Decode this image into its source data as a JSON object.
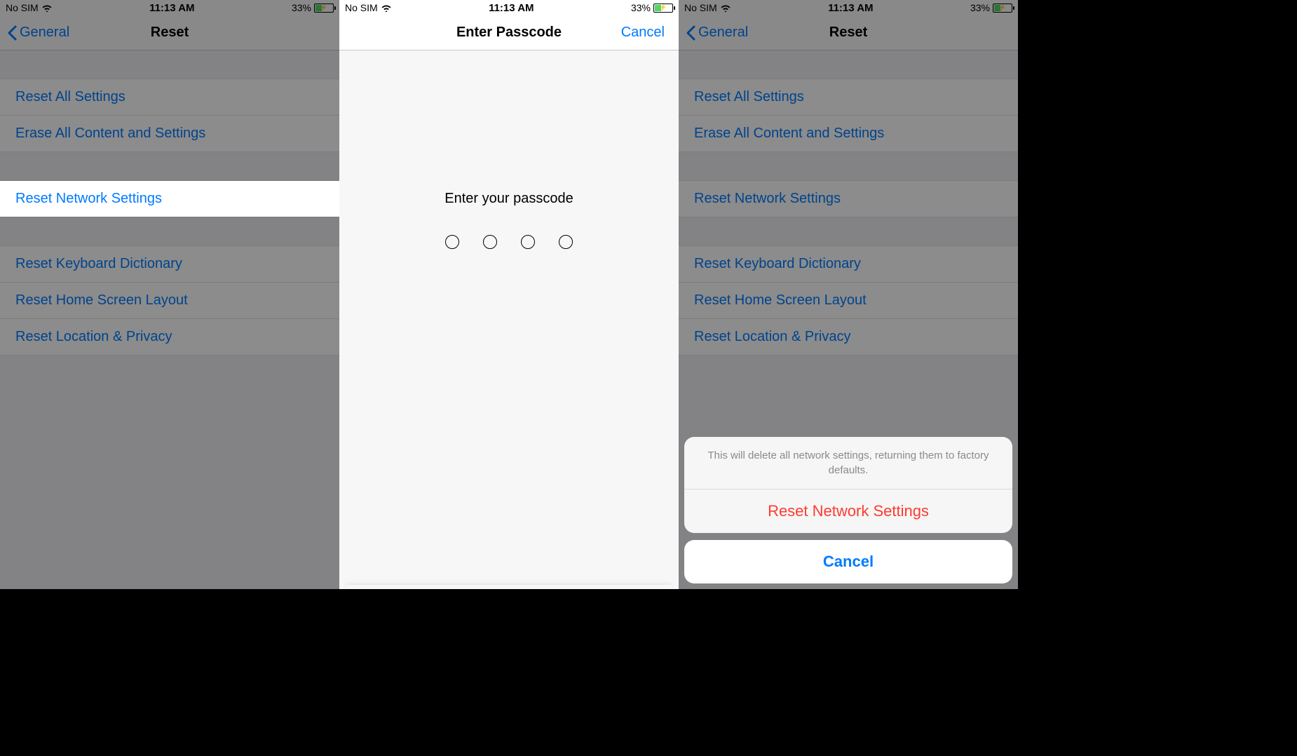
{
  "status": {
    "carrier": "No SIM",
    "time": "11:13 AM",
    "battery_pct": "33%"
  },
  "reset_screen": {
    "back_label": "General",
    "title": "Reset",
    "rows": {
      "reset_all": "Reset All Settings",
      "erase_all": "Erase All Content and Settings",
      "reset_network": "Reset Network Settings",
      "reset_keyboard": "Reset Keyboard Dictionary",
      "reset_home": "Reset Home Screen Layout",
      "reset_location": "Reset Location & Privacy"
    }
  },
  "passcode_screen": {
    "title": "Enter Passcode",
    "cancel": "Cancel",
    "prompt": "Enter your passcode",
    "digits": 4
  },
  "confirm_sheet": {
    "message": "This will delete all network settings, returning them to factory defaults.",
    "action": "Reset Network Settings",
    "cancel": "Cancel"
  }
}
